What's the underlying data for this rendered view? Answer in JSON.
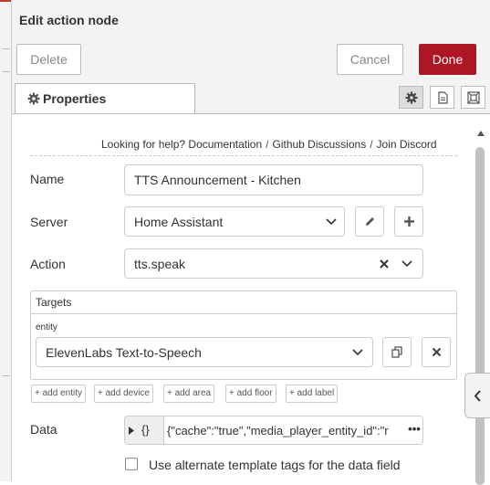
{
  "tray": {
    "title": "Edit action node",
    "delete_label": "Delete",
    "cancel_label": "Cancel",
    "done_label": "Done"
  },
  "tabs": {
    "properties_label": "Properties",
    "icons": [
      "gear-icon",
      "description-icon",
      "appearance-icon"
    ]
  },
  "help": {
    "prefix": "Looking for help?",
    "links": [
      "Documentation",
      "Github Discussions",
      "Join Discord"
    ]
  },
  "form": {
    "name_label": "Name",
    "name_value": "TTS Announcement - Kitchen",
    "server_label": "Server",
    "server_value": "Home Assistant",
    "action_label": "Action",
    "action_value": "tts.speak",
    "targets_title": "Targets",
    "entity_label": "entity",
    "entity_value": "ElevenLabs Text-to-Speech",
    "add_buttons": [
      "add entity",
      "add device",
      "add area",
      "add floor",
      "add label"
    ],
    "data_label": "Data",
    "data_prefix": "{}",
    "data_value": "{\"cache\":\"true\",\"media_player_entity_id\":\"r",
    "alt_template_label": "Use alternate template tags for the data field"
  },
  "colors": {
    "done_bg": "#ad1625",
    "tray_bg": "#f3f3f3"
  }
}
